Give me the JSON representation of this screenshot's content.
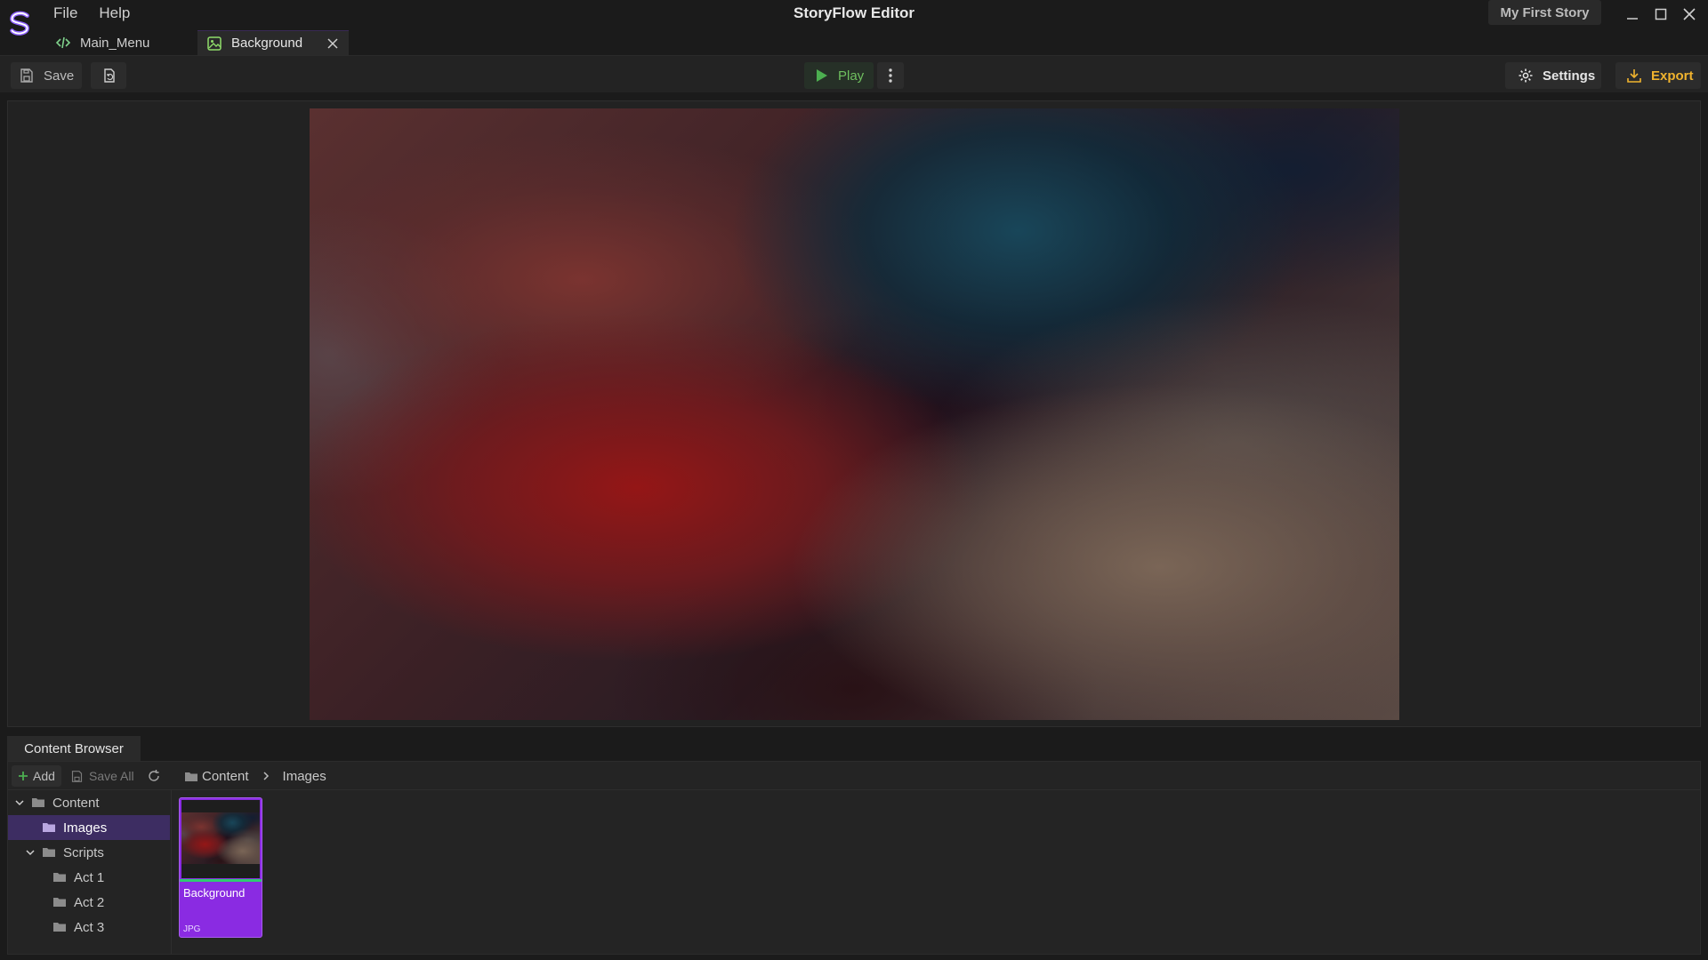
{
  "app": {
    "title": "StoryFlow Editor",
    "project_name": "My First Story",
    "accent": "#8a2be2"
  },
  "menu": {
    "items": [
      "File",
      "Help"
    ]
  },
  "tabs": [
    {
      "label": "Main_Menu",
      "icon": "code-icon",
      "active": false
    },
    {
      "label": "Background",
      "icon": "image-icon",
      "active": true
    }
  ],
  "toolbar": {
    "save_label": "Save",
    "play_label": "Play",
    "settings_label": "Settings",
    "export_label": "Export"
  },
  "content_browser": {
    "tab_label": "Content Browser",
    "add_label": "Add",
    "save_all_label": "Save All",
    "breadcrumb": [
      "Content",
      "Images"
    ],
    "tree": [
      {
        "label": "Content",
        "level": 0,
        "expanded": true,
        "selected": false
      },
      {
        "label": "Images",
        "level": 1,
        "expanded": false,
        "selected": true
      },
      {
        "label": "Scripts",
        "level": 1,
        "expanded": true,
        "selected": false
      },
      {
        "label": "Act 1",
        "level": 2,
        "selected": false
      },
      {
        "label": "Act 2",
        "level": 2,
        "selected": false
      },
      {
        "label": "Act 3",
        "level": 2,
        "selected": false
      }
    ],
    "assets": [
      {
        "name": "Background",
        "type": "JPG"
      }
    ]
  }
}
